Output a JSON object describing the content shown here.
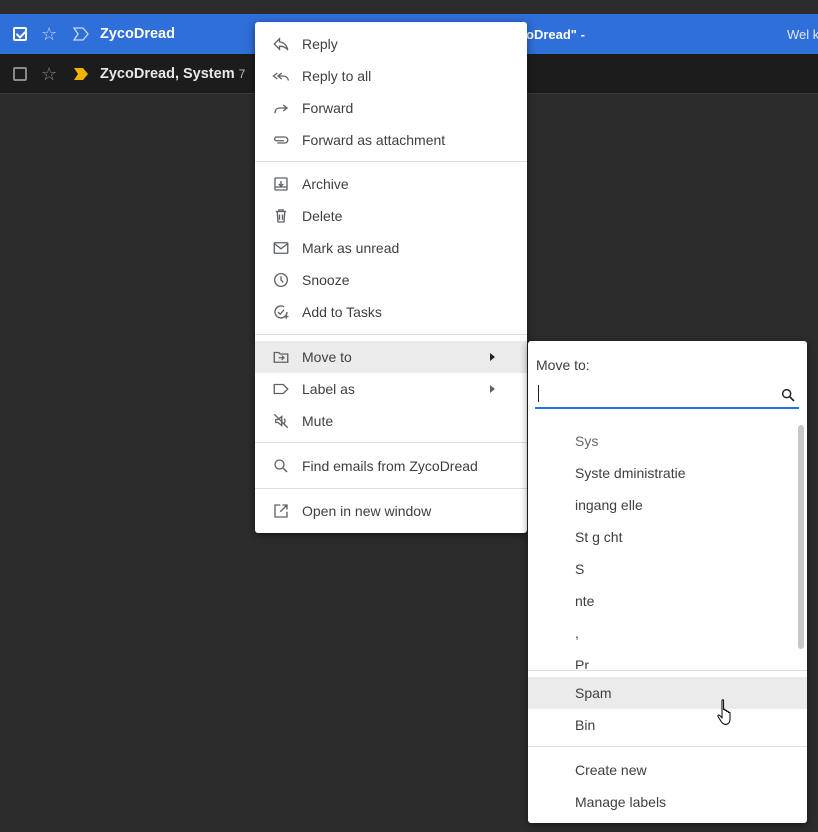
{
  "email_rows": [
    {
      "sender": "ZycoDread",
      "count": "",
      "snippet": "oDread\" -",
      "snippet_tail": "Wel k",
      "selected": true
    },
    {
      "sender": "ZycoDread, System",
      "count": "7",
      "snippet": "",
      "snippet_tail": "",
      "selected": false
    }
  ],
  "context_menu": {
    "items": [
      {
        "label": "Reply",
        "icon": "reply-icon"
      },
      {
        "label": "Reply to all",
        "icon": "reply-all-icon"
      },
      {
        "label": "Forward",
        "icon": "forward-icon"
      },
      {
        "label": "Forward as attachment",
        "icon": "attachment-icon"
      },
      {
        "label": "Archive",
        "icon": "archive-icon"
      },
      {
        "label": "Delete",
        "icon": "delete-icon"
      },
      {
        "label": "Mark as unread",
        "icon": "mail-icon"
      },
      {
        "label": "Snooze",
        "icon": "clock-icon"
      },
      {
        "label": "Add to Tasks",
        "icon": "add-task-icon"
      },
      {
        "label": "Move to",
        "icon": "move-to-icon",
        "submenu": true,
        "highlighted": true
      },
      {
        "label": "Label as",
        "icon": "label-icon",
        "submenu": true
      },
      {
        "label": "Mute",
        "icon": "mute-icon"
      },
      {
        "label": "Find emails from ZycoDread",
        "icon": "search-icon"
      },
      {
        "label": "Open in new window",
        "icon": "open-new-window-icon"
      }
    ]
  },
  "move_to_menu": {
    "title": "Move to:",
    "search_value": "",
    "folders": [
      "Sys",
      "Syste            dministratie",
      "              ingang    elle",
      "St                  g           cht",
      "S",
      "         nte",
      "  ,",
      "Pr"
    ],
    "system_items": [
      {
        "label": "Spam",
        "highlighted": true
      },
      {
        "label": "Bin"
      }
    ],
    "action_items": [
      {
        "label": "Create new"
      },
      {
        "label": "Manage labels"
      }
    ]
  },
  "colors": {
    "selected_row": "#2f6fd9",
    "menu_bg": "#ffffff",
    "menu_text": "#3c4043",
    "accent": "#1a73e8",
    "important_marker": "#f0b400"
  }
}
